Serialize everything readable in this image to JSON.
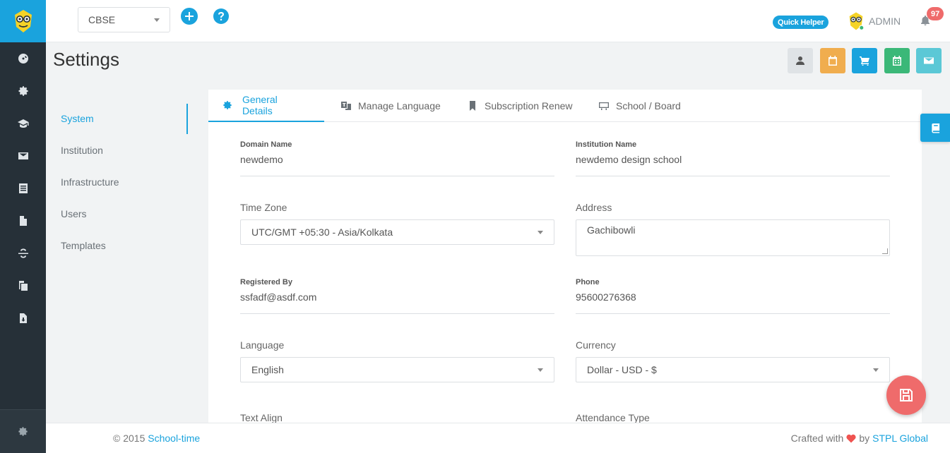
{
  "topbar": {
    "board_select_value": "CBSE",
    "quick_helper_label": "Quick Helper",
    "user_label": "ADMIN",
    "notification_count": "97"
  },
  "page": {
    "title": "Settings"
  },
  "header_buttons": [
    {
      "icon": "user-icon",
      "color": "#dfe3e6"
    },
    {
      "icon": "calendar-icon",
      "color": "#f0ad4e"
    },
    {
      "icon": "cart-icon",
      "color": "#1aa3dd"
    },
    {
      "icon": "calendar-grid-icon",
      "color": "#3bb878"
    },
    {
      "icon": "mail-icon",
      "color": "#5bc8d6"
    }
  ],
  "sub_menu": {
    "items": [
      "System",
      "Institution",
      "Infrastructure",
      "Users",
      "Templates"
    ],
    "active": "System"
  },
  "tabs": [
    {
      "label": "General Details",
      "icon": "gear-icon"
    },
    {
      "label": "Manage Language",
      "icon": "translate-icon"
    },
    {
      "label": "Subscription Renew",
      "icon": "bookmark-icon"
    },
    {
      "label": "School / Board",
      "icon": "board-icon"
    }
  ],
  "form": {
    "domain_name": {
      "label": "Domain Name",
      "value": "newdemo"
    },
    "institution_name": {
      "label": "Institution Name",
      "value": "newdemo design school"
    },
    "time_zone": {
      "label": "Time Zone",
      "value": "UTC/GMT +05:30 - Asia/Kolkata"
    },
    "address": {
      "label": "Address",
      "value": "Gachibowli"
    },
    "registered_by": {
      "label": "Registered By",
      "value": "ssfadf@asdf.com"
    },
    "phone": {
      "label": "Phone",
      "value": "95600276368"
    },
    "language": {
      "label": "Language",
      "value": "English"
    },
    "currency": {
      "label": "Currency",
      "value": "Dollar - USD - $"
    },
    "text_align": {
      "label": "Text Align"
    },
    "attendance_type": {
      "label": "Attendance Type"
    }
  },
  "footer": {
    "copyright_prefix": "© 2015",
    "copyright_link": "School-time",
    "crafted_prefix": "Crafted with",
    "crafted_by": "by",
    "crafted_link": "STPL Global"
  },
  "colors": {
    "accent": "#1aa3dd",
    "rail": "#263038",
    "danger": "#ef6b6b"
  }
}
